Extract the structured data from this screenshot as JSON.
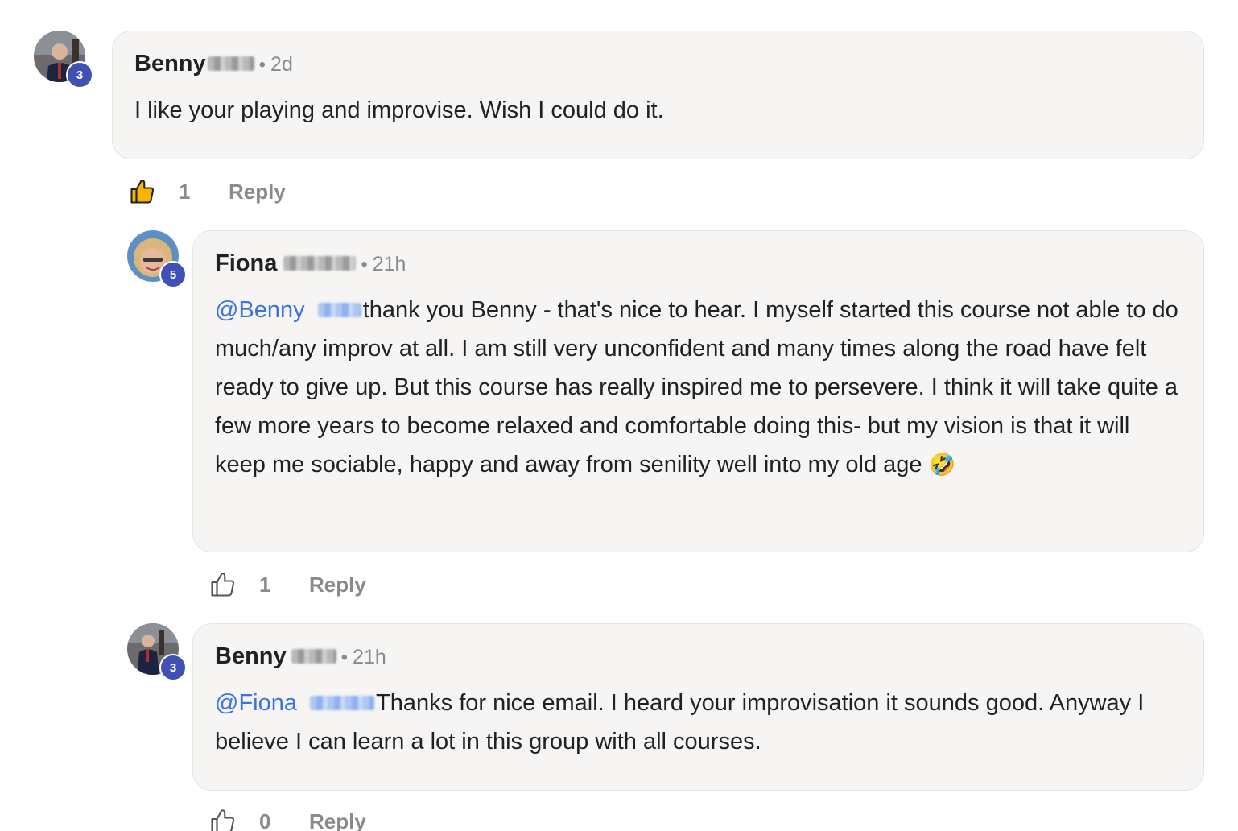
{
  "comments": [
    {
      "author": "Benny",
      "level": "3",
      "separator": "•",
      "time": "2d",
      "text": "I like your playing and improvise. Wish I could do it.",
      "likes": "1",
      "reply_label": "Reply",
      "liked": true
    },
    {
      "author": "Fiona",
      "level": "5",
      "separator": "•",
      "time": "21h",
      "mention": "@Benny",
      "text": "thank you Benny - that's nice to hear. I myself started this course not able to do much/any improv at all. I am still very unconfident and many times along the road have felt ready to give up. But this course has really inspired me to persevere. I think it will take quite a few more years to become relaxed and comfortable doing this- but my vision is that it will keep me sociable, happy and away from senility well into my old age",
      "emoji": "🤣",
      "likes": "1",
      "reply_label": "Reply",
      "liked": false
    },
    {
      "author": "Benny",
      "level": "3",
      "separator": "•",
      "time": "21h",
      "mention": "@Fiona",
      "text": "Thanks for nice email. I heard your improvisation it sounds good. Anyway I believe I can learn a lot in this group with all courses.",
      "likes": "0",
      "reply_label": "Reply",
      "liked": false
    }
  ],
  "colors": {
    "badge": "#3f51b5",
    "mention": "#3b73e0",
    "liked_thumb": "#f7b500",
    "bubble_bg": "#f6f5f4"
  }
}
